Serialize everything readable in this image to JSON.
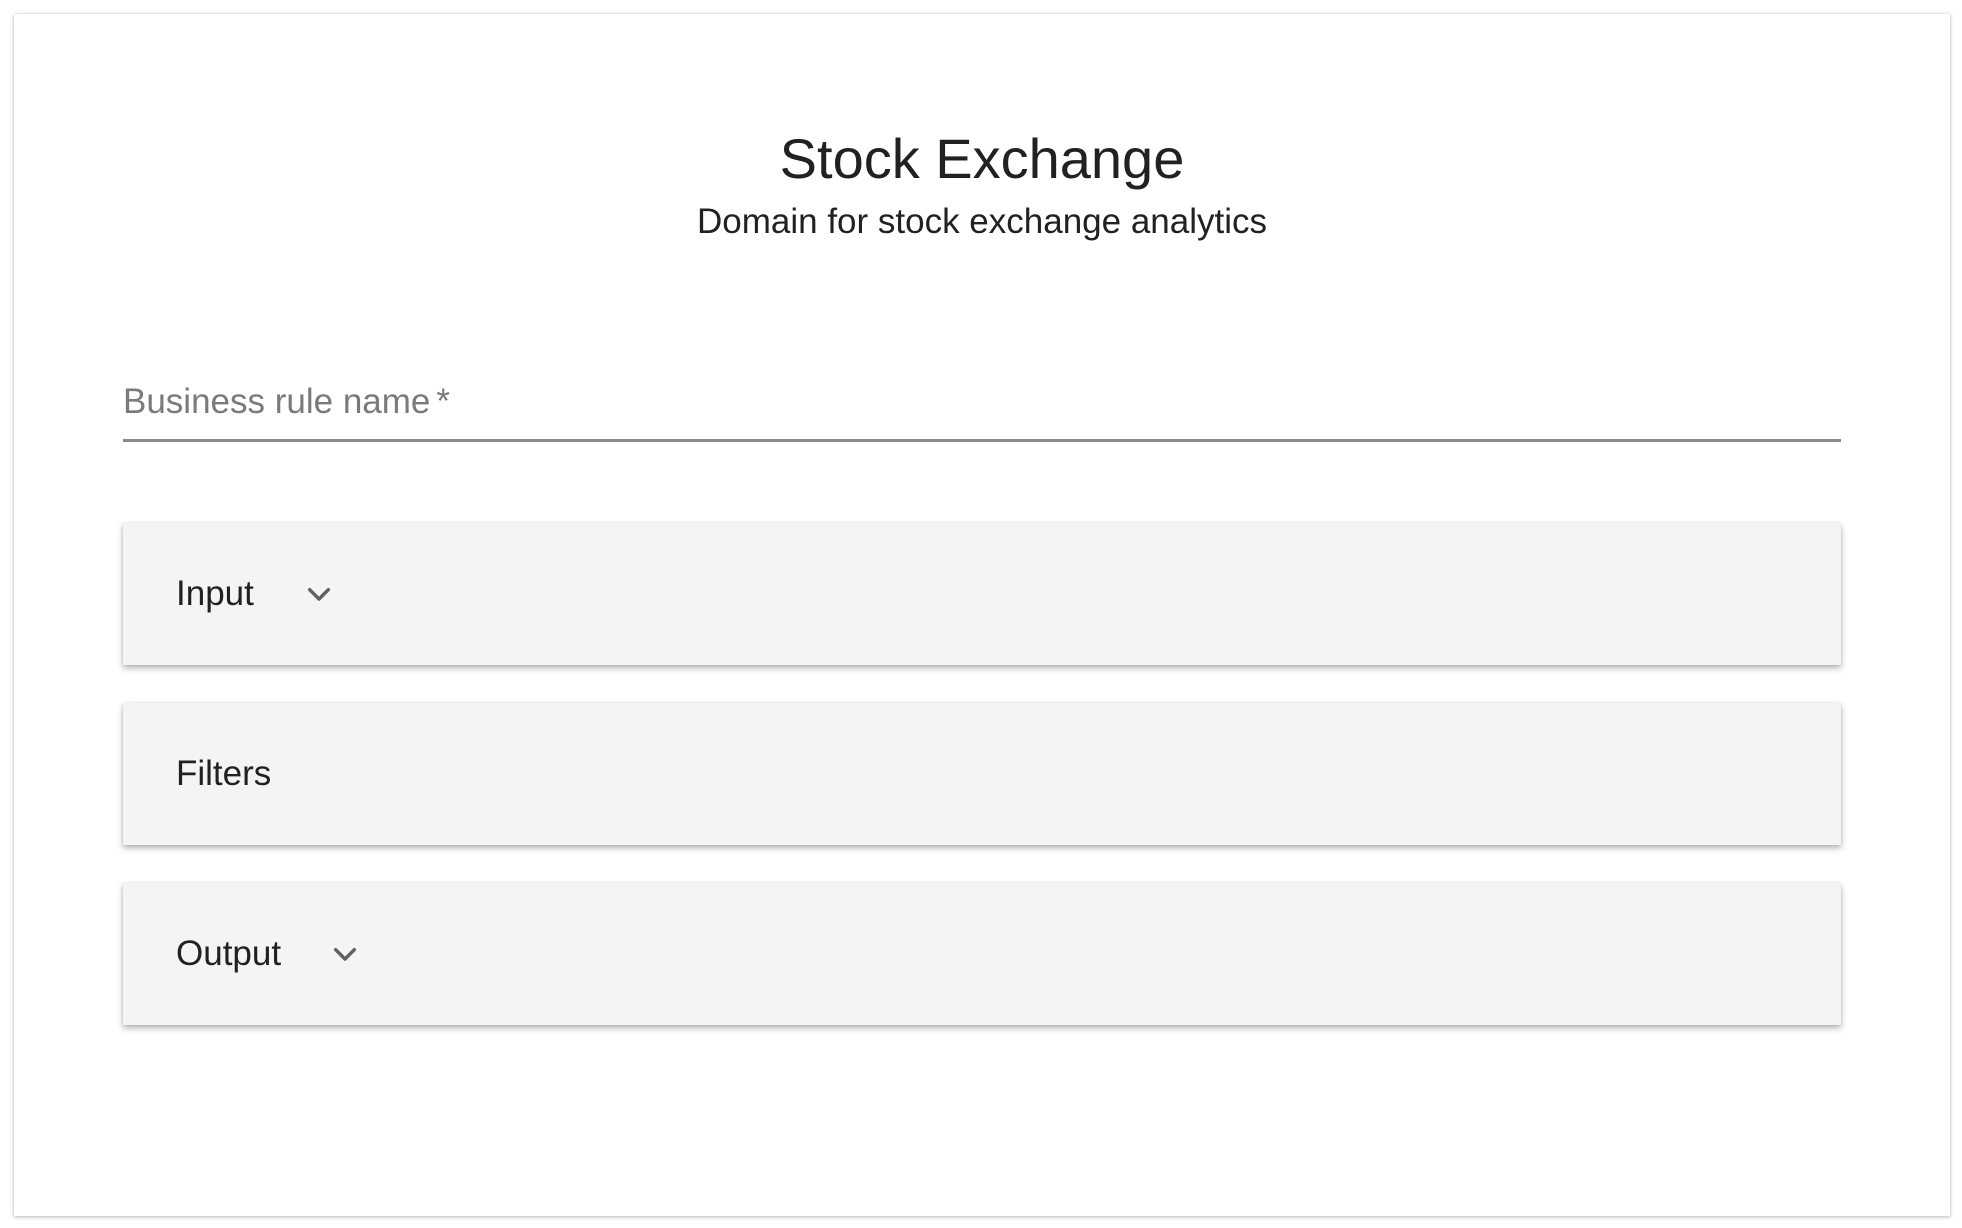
{
  "header": {
    "title": "Stock Exchange",
    "subtitle": "Domain for stock exchange analytics"
  },
  "form": {
    "rule_name_label": "Business rule name",
    "required_marker": "*",
    "rule_name_value": ""
  },
  "panels": [
    {
      "label": "Input",
      "icon": "chevron-down-icon"
    },
    {
      "label": "Filters"
    },
    {
      "label": "Output",
      "icon": "chevron-down-icon"
    }
  ],
  "colors": {
    "panel_background": "#f4f4f4",
    "field_underline": "#8a8a8a",
    "label_gray": "#7a7a7a",
    "text": "#212121"
  }
}
